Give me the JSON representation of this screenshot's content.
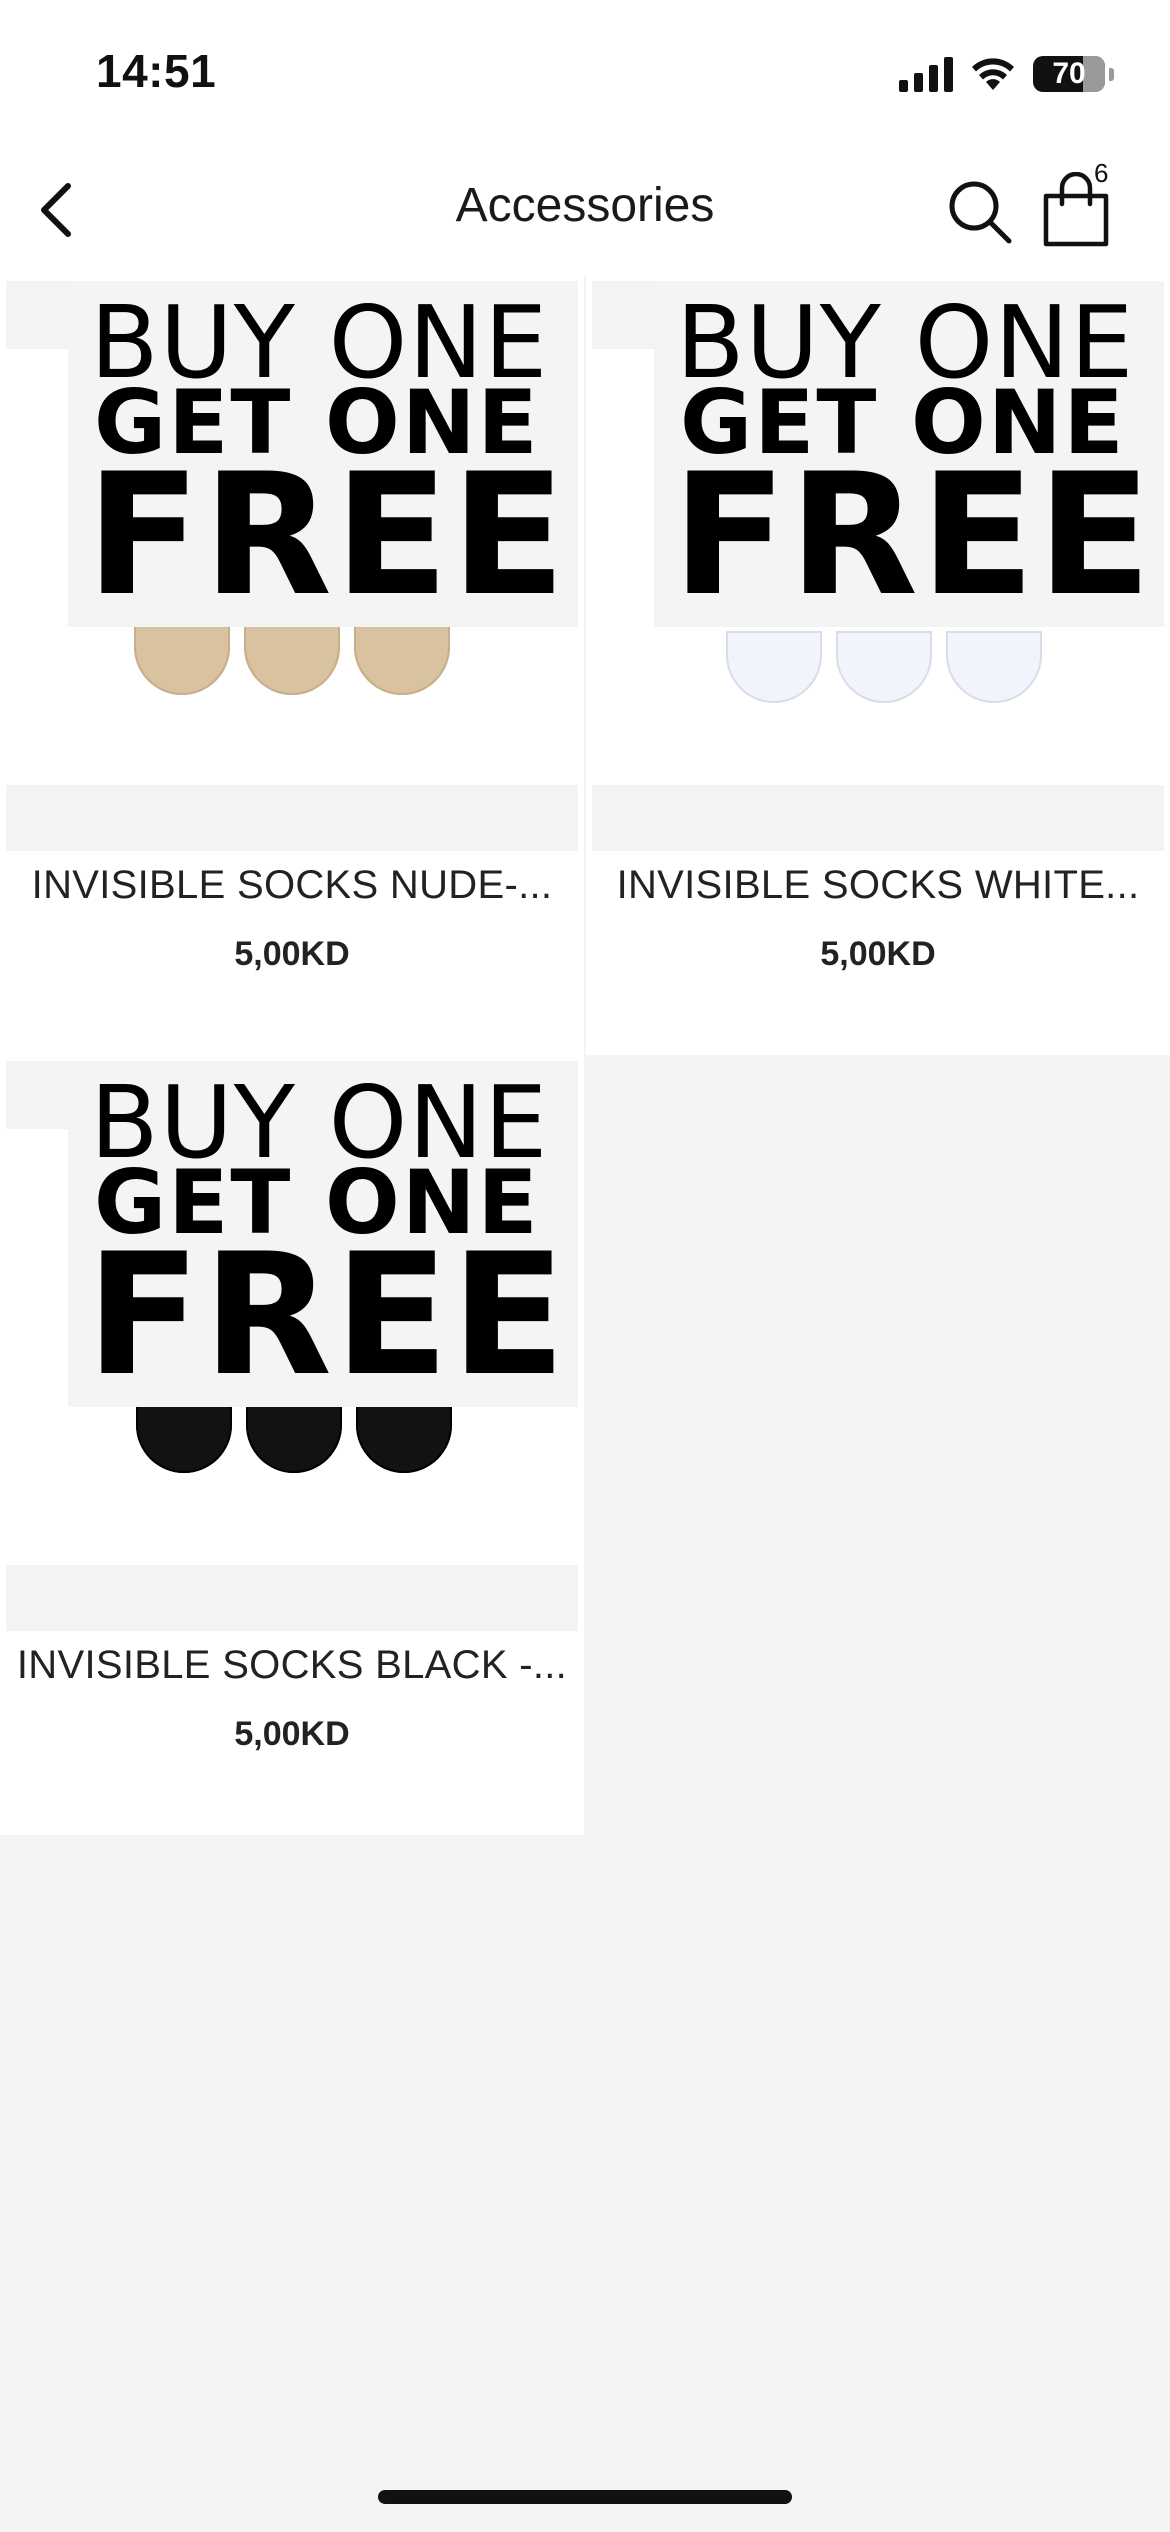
{
  "status_bar": {
    "time": "14:51",
    "battery_percent": "70",
    "battery_level": 0.7
  },
  "header": {
    "title": "Accessories",
    "cart_count": "6",
    "icons": {
      "back": "chevron-left-icon",
      "search": "search-icon",
      "cart": "shopping-bag-icon"
    }
  },
  "products": [
    {
      "name": "INVISIBLE SOCKS NUDE-...",
      "price": "5,00KD",
      "promo": {
        "line1": "BUY ONE",
        "line2": "GET ONE",
        "line3": "FREE"
      },
      "sock_color": "#d9c2a0",
      "sock_outline": "#c8ae88"
    },
    {
      "name": "INVISIBLE SOCKS WHITE...",
      "price": "5,00KD",
      "promo": {
        "line1": "BUY ONE",
        "line2": "GET ONE",
        "line3": "FREE"
      },
      "sock_color": "#f2f4fb",
      "sock_outline": "#d9dcea"
    },
    {
      "name": "INVISIBLE SOCKS BLACK -...",
      "price": "5,00KD",
      "promo": {
        "line1": "BUY ONE",
        "line2": "GET ONE",
        "line3": "FREE"
      },
      "sock_color": "#121212",
      "sock_outline": "#000000"
    }
  ]
}
